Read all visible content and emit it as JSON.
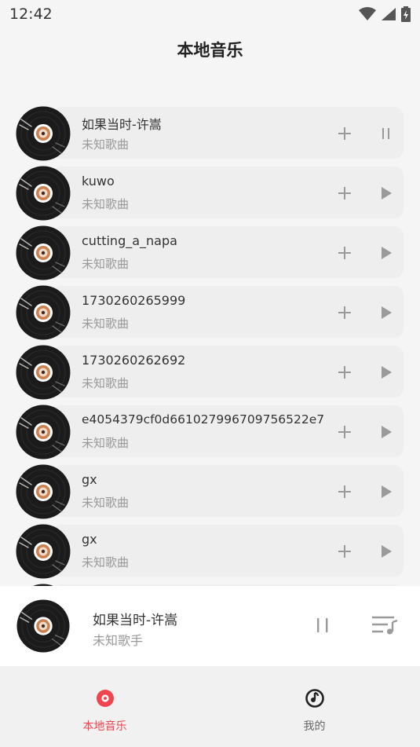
{
  "status_bar": {
    "time": "12:42"
  },
  "header": {
    "title": "本地音乐"
  },
  "songs": [
    {
      "title": "如果当时-许嵩",
      "subtitle": "未知歌曲",
      "state": "playing"
    },
    {
      "title": "kuwo",
      "subtitle": "未知歌曲",
      "state": "paused"
    },
    {
      "title": "cutting_a_napa",
      "subtitle": "未知歌曲",
      "state": "paused"
    },
    {
      "title": "1730260265999",
      "subtitle": "未知歌曲",
      "state": "paused"
    },
    {
      "title": "1730260262692",
      "subtitle": "未知歌曲",
      "state": "paused"
    },
    {
      "title": "e4054379cf0d661027996709756522e7",
      "subtitle": "未知歌曲",
      "state": "paused"
    },
    {
      "title": "gx",
      "subtitle": "未知歌曲",
      "state": "paused"
    },
    {
      "title": "gx",
      "subtitle": "未知歌曲",
      "state": "paused"
    }
  ],
  "player": {
    "title": "如果当时-许嵩",
    "artist": "未知歌手"
  },
  "nav": {
    "tabs": [
      {
        "label": "本地音乐",
        "icon": "disc-icon",
        "active": true
      },
      {
        "label": "我的",
        "icon": "music-note-icon",
        "active": false
      }
    ]
  },
  "colors": {
    "accent": "#f0454e",
    "background": "#f5f5f5",
    "card": "#eeeeee"
  }
}
